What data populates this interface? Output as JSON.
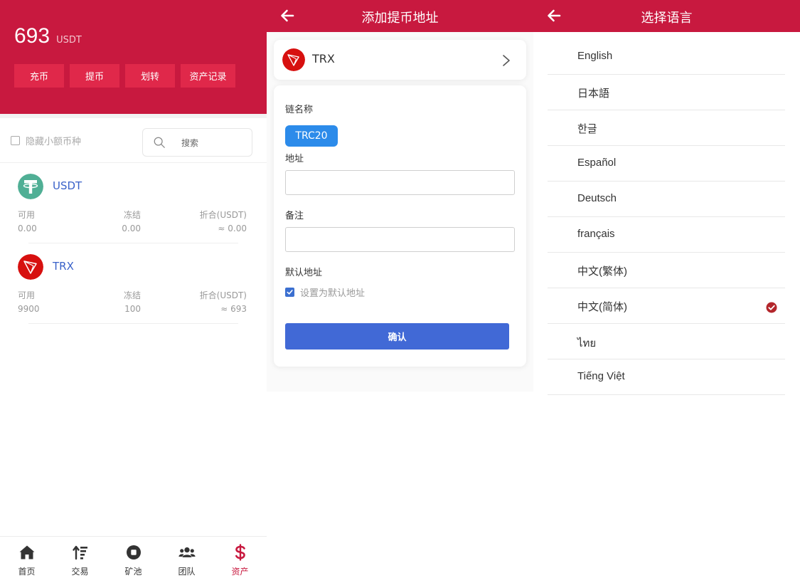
{
  "colors": {
    "brand": "#c8193f",
    "tether": "#50af95",
    "tron": "#d7100f",
    "link_blue": "#3a62c9",
    "chip_blue": "#2c8bea",
    "confirm_blue": "#4169d6"
  },
  "assets": {
    "total_value": "693",
    "total_unit": "USDT",
    "actions": [
      "充币",
      "提币",
      "划转",
      "资产记录"
    ],
    "hide_small_label": "隐藏小额币种",
    "search_placeholder": "搜索",
    "coins": [
      {
        "name": "USDT",
        "icon": "tether-icon",
        "available_label": "可用",
        "available": "0.00",
        "frozen_label": "冻结",
        "frozen": "0.00",
        "converted_label": "折合(USDT)",
        "converted": "≈ 0.00"
      },
      {
        "name": "TRX",
        "icon": "tron-icon",
        "available_label": "可用",
        "available": "9900",
        "frozen_label": "冻结",
        "frozen": "100",
        "converted_label": "折合(USDT)",
        "converted": "≈ 693"
      }
    ],
    "tabbar": [
      {
        "label": "首页",
        "icon": "home-icon",
        "active": false
      },
      {
        "label": "交易",
        "icon": "sort-icon",
        "active": false
      },
      {
        "label": "矿池",
        "icon": "stop-circle-icon",
        "active": false
      },
      {
        "label": "团队",
        "icon": "users-icon",
        "active": false
      },
      {
        "label": "资产",
        "icon": "dollar-icon",
        "active": true
      }
    ]
  },
  "withdraw_address": {
    "title": "添加提币地址",
    "coin": "TRX",
    "chain_label": "链名称",
    "chain_value": "TRC20",
    "address_label": "地址",
    "address_value": "",
    "note_label": "备注",
    "note_value": "",
    "default_label": "默认地址",
    "default_checkbox_label": "设置为默认地址",
    "default_checked": true,
    "confirm_label": "确认"
  },
  "language": {
    "title": "选择语言",
    "items": [
      "English",
      "日本語",
      "한글",
      "Español",
      "Deutsch",
      "français",
      "中文(繁体)",
      "中文(简体)",
      "ไทย",
      "Tiếng Việt"
    ],
    "selected": "中文(简体)"
  }
}
